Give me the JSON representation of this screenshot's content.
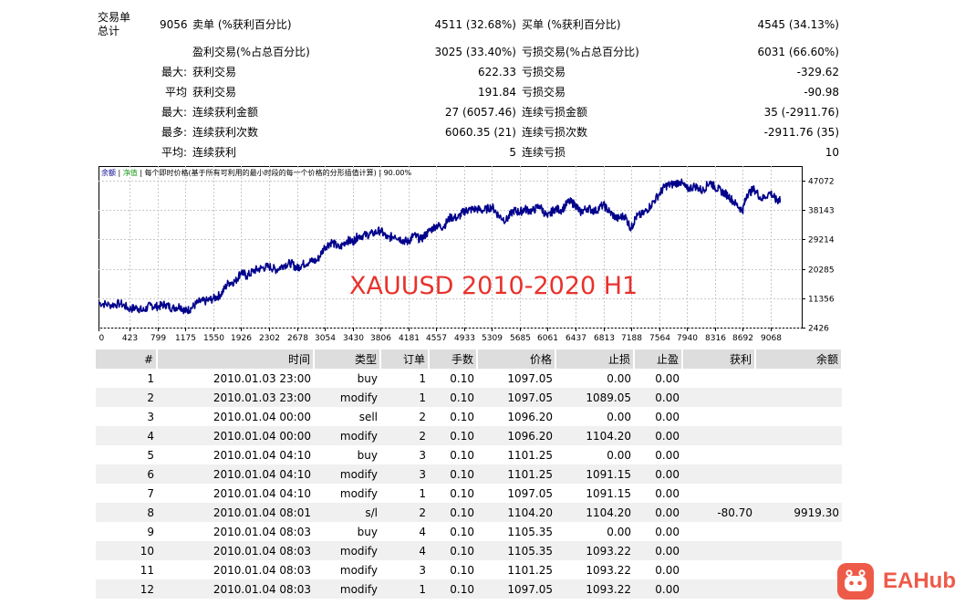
{
  "summary": {
    "trades_label_1": "交易单",
    "trades_label_2": "总计",
    "total_trades": "9056",
    "short_label": "卖单 (%获利百分比)",
    "short_value": "4511 (32.68%)",
    "long_label": "买单 (%获利百分比)",
    "long_value": "4545 (34.13%)",
    "rows": [
      {
        "prefix": "",
        "l_label": "盈利交易(%占总百分比)",
        "l_value": "3025 (33.40%)",
        "r_label": "亏损交易(%占总百分比)",
        "r_value": "6031 (66.60%)"
      },
      {
        "prefix": "最大:",
        "l_label": "获利交易",
        "l_value": "622.33",
        "r_label": "亏损交易",
        "r_value": "-329.62"
      },
      {
        "prefix": "平均",
        "l_label": "获利交易",
        "l_value": "191.84",
        "r_label": "亏损交易",
        "r_value": "-90.98"
      },
      {
        "prefix": "最大:",
        "l_label": "连续获利金额",
        "l_value": "27 (6057.46)",
        "r_label": "连续亏损金额",
        "r_value": "35 (-2911.76)"
      },
      {
        "prefix": "最多:",
        "l_label": "连续获利次数",
        "l_value": "6060.35 (21)",
        "r_label": "连续亏损次数",
        "r_value": "-2911.76 (35)"
      },
      {
        "prefix": "平均:",
        "l_label": "连续获利",
        "l_value": "5",
        "r_label": "连续亏损",
        "r_value": "10"
      }
    ]
  },
  "chart_data": {
    "type": "line",
    "legend_text": [
      "余额",
      "净值",
      "每个即时价格(基于所有可利用的最小时段的每一个价格的分形插值计算)",
      "90.00%"
    ],
    "annotation": "XAUUSD 2010-2020 H1",
    "x_ticks": [
      0,
      423,
      799,
      1175,
      1550,
      1926,
      2302,
      2678,
      3054,
      3430,
      3806,
      4181,
      4557,
      4933,
      5309,
      5685,
      6061,
      6437,
      6813,
      7188,
      7564,
      7940,
      8316,
      8692,
      9068
    ],
    "y_ticks": [
      2426,
      11356,
      20285,
      29214,
      38143,
      47072
    ],
    "xlim": [
      0,
      9490
    ],
    "ylim": [
      2426,
      51536
    ],
    "grid": true,
    "series_color": "#00008b",
    "series": [
      {
        "x": [
          0,
          150,
          300,
          423,
          520,
          600,
          700,
          799,
          900,
          1000,
          1100,
          1175,
          1250,
          1350,
          1450,
          1550,
          1650,
          1750,
          1850,
          1926,
          2000,
          2100,
          2200,
          2302,
          2400,
          2500,
          2600,
          2678,
          2750,
          2850,
          2950,
          3054,
          3150,
          3250,
          3350,
          3430,
          3500,
          3600,
          3700,
          3806,
          3900,
          4000,
          4100,
          4181,
          4250,
          4350,
          4450,
          4557,
          4650,
          4750,
          4850,
          4933,
          5000,
          5100,
          5200,
          5309,
          5400,
          5500,
          5600,
          5685,
          5750,
          5850,
          5950,
          6061,
          6150,
          6250,
          6350,
          6437,
          6500,
          6600,
          6700,
          6813,
          6900,
          7000,
          7100,
          7188,
          7250,
          7350,
          7450,
          7564,
          7650,
          7750,
          7850,
          7940,
          8050,
          8150,
          8250,
          8316,
          8400,
          8500,
          8600,
          8692,
          8750,
          8850,
          8950,
          9068,
          9150,
          9200
        ],
        "y": [
          10000,
          9300,
          9700,
          8100,
          8500,
          7500,
          9200,
          8800,
          9500,
          8300,
          9000,
          7400,
          8300,
          10200,
          10500,
          11200,
          12500,
          16000,
          16500,
          19500,
          18000,
          19800,
          20500,
          21000,
          20000,
          21500,
          22000,
          20500,
          21600,
          22500,
          22800,
          27000,
          28500,
          26500,
          29000,
          28500,
          30200,
          30500,
          31000,
          32000,
          29500,
          30500,
          29000,
          28500,
          30500,
          29200,
          31500,
          33500,
          33000,
          36000,
          35800,
          37800,
          38200,
          38500,
          38000,
          39200,
          36500,
          35000,
          38000,
          37500,
          38500,
          37800,
          39500,
          36000,
          38500,
          38200,
          40800,
          39800,
          37500,
          38800,
          37800,
          39800,
          37500,
          35500,
          36500,
          32500,
          36000,
          37000,
          39500,
          43000,
          45500,
          46000,
          46800,
          44500,
          45500,
          44000,
          46800,
          45200,
          44000,
          42500,
          40000,
          38000,
          43000,
          44500,
          41500,
          43500,
          41000,
          41500
        ]
      }
    ]
  },
  "table": {
    "headers": [
      "#",
      "时间",
      "类型",
      "订单",
      "手数",
      "价格",
      "止损",
      "止盈",
      "获利",
      "余额"
    ],
    "rows": [
      [
        "1",
        "2010.01.03 23:00",
        "buy",
        "1",
        "0.10",
        "1097.05",
        "0.00",
        "0.00",
        "",
        ""
      ],
      [
        "2",
        "2010.01.03 23:00",
        "modify",
        "1",
        "0.10",
        "1097.05",
        "1089.05",
        "0.00",
        "",
        ""
      ],
      [
        "3",
        "2010.01.04 00:00",
        "sell",
        "2",
        "0.10",
        "1096.20",
        "0.00",
        "0.00",
        "",
        ""
      ],
      [
        "4",
        "2010.01.04 00:00",
        "modify",
        "2",
        "0.10",
        "1096.20",
        "1104.20",
        "0.00",
        "",
        ""
      ],
      [
        "5",
        "2010.01.04 04:10",
        "buy",
        "3",
        "0.10",
        "1101.25",
        "0.00",
        "0.00",
        "",
        ""
      ],
      [
        "6",
        "2010.01.04 04:10",
        "modify",
        "3",
        "0.10",
        "1101.25",
        "1091.15",
        "0.00",
        "",
        ""
      ],
      [
        "7",
        "2010.01.04 04:10",
        "modify",
        "1",
        "0.10",
        "1097.05",
        "1091.15",
        "0.00",
        "",
        ""
      ],
      [
        "8",
        "2010.01.04 08:01",
        "s/l",
        "2",
        "0.10",
        "1104.20",
        "1104.20",
        "0.00",
        "-80.70",
        "9919.30"
      ],
      [
        "9",
        "2010.01.04 08:03",
        "buy",
        "4",
        "0.10",
        "1105.35",
        "0.00",
        "0.00",
        "",
        ""
      ],
      [
        "10",
        "2010.01.04 08:03",
        "modify",
        "4",
        "0.10",
        "1105.35",
        "1093.22",
        "0.00",
        "",
        ""
      ],
      [
        "11",
        "2010.01.04 08:03",
        "modify",
        "3",
        "0.10",
        "1101.25",
        "1093.22",
        "0.00",
        "",
        ""
      ],
      [
        "12",
        "2010.01.04 08:03",
        "modify",
        "1",
        "0.10",
        "1097.05",
        "1093.22",
        "0.00",
        "",
        ""
      ]
    ]
  },
  "watermark": {
    "brand": "EAHub",
    "icon": "robot-face-icon",
    "color": "#ee5a48"
  }
}
